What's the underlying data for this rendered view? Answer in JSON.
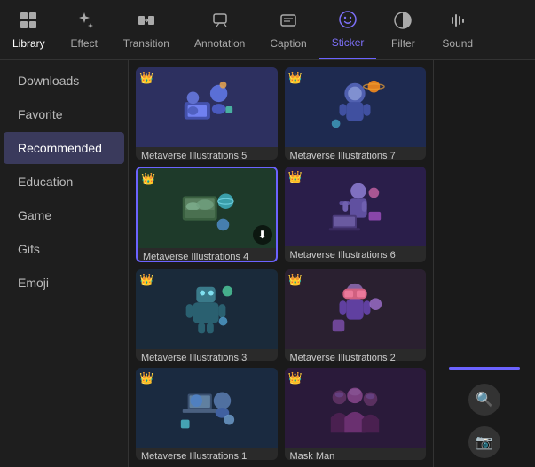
{
  "toolbar": {
    "items": [
      {
        "label": "Library",
        "icon": "⊞",
        "active": false
      },
      {
        "label": "Effect",
        "icon": "✦",
        "active": false
      },
      {
        "label": "Transition",
        "icon": "⇄",
        "active": false
      },
      {
        "label": "Annotation",
        "icon": "✎",
        "active": false
      },
      {
        "label": "Caption",
        "icon": "T|",
        "active": false
      },
      {
        "label": "Sticker",
        "icon": "☺",
        "active": true
      },
      {
        "label": "Filter",
        "icon": "◑",
        "active": false
      },
      {
        "label": "Sound",
        "icon": "♫",
        "active": false
      }
    ]
  },
  "sidebar": {
    "items": [
      {
        "label": "Downloads",
        "active": false
      },
      {
        "label": "Favorite",
        "active": false
      },
      {
        "label": "Recommended",
        "active": true
      },
      {
        "label": "Education",
        "active": false
      },
      {
        "label": "Game",
        "active": false
      },
      {
        "label": "Gifs",
        "active": false
      },
      {
        "label": "Emoji",
        "active": false
      }
    ]
  },
  "stickers": [
    {
      "label": "Metaverse Illustrations 5",
      "crown": true,
      "selected": false,
      "download": false,
      "color": "#2d3060"
    },
    {
      "label": "Metaverse Illustrations 7",
      "crown": true,
      "selected": false,
      "download": false,
      "color": "#1e2a50"
    },
    {
      "label": "Metaverse Illustrations 4",
      "crown": true,
      "selected": true,
      "download": true,
      "color": "#1e3a2a"
    },
    {
      "label": "Metaverse Illustrations 6",
      "crown": true,
      "selected": false,
      "download": false,
      "color": "#2a1e4a"
    },
    {
      "label": "Metaverse Illustrations 3",
      "crown": true,
      "selected": false,
      "download": false,
      "color": "#1a2a3a"
    },
    {
      "label": "Metaverse Illustrations 2",
      "crown": true,
      "selected": false,
      "download": false,
      "color": "#2a2030"
    },
    {
      "label": "Metaverse Illustrations 1",
      "crown": true,
      "selected": false,
      "download": false,
      "color": "#1a2a40"
    },
    {
      "label": "Mask Man",
      "crown": true,
      "selected": false,
      "download": false,
      "color": "#2a1a3a"
    }
  ],
  "right_panel": {
    "search_icon": "🔍",
    "camera_icon": "📷"
  }
}
